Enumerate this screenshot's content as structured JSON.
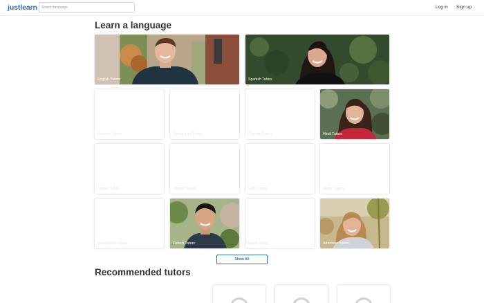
{
  "header": {
    "logo": "justlearn",
    "search_placeholder": "Search language",
    "login_label": "Log in",
    "signup_label": "Sign up"
  },
  "learn": {
    "title": "Learn a language",
    "cards": [
      {
        "label": "English Tutors"
      },
      {
        "label": "Spanish Tutors"
      },
      {
        "label": "German Tutors"
      },
      {
        "label": "Portuguese Tutors"
      },
      {
        "label": "Russian Tutors"
      },
      {
        "label": "Hindi Tutors"
      },
      {
        "label": "Turkish Tutors"
      },
      {
        "label": "Filipino Tutors"
      },
      {
        "label": "Urdu Tutors"
      },
      {
        "label": "Arabic Tutors"
      },
      {
        "label": "Vietnamese Tutors"
      },
      {
        "label": "French Tutors"
      },
      {
        "label": "Italian Tutors"
      },
      {
        "label": "American Tutors"
      }
    ],
    "show_all_label": "Show All"
  },
  "recommended": {
    "title": "Recommended tutors"
  },
  "colors": {
    "brand": "#2f6fb6",
    "text": "#333333"
  }
}
